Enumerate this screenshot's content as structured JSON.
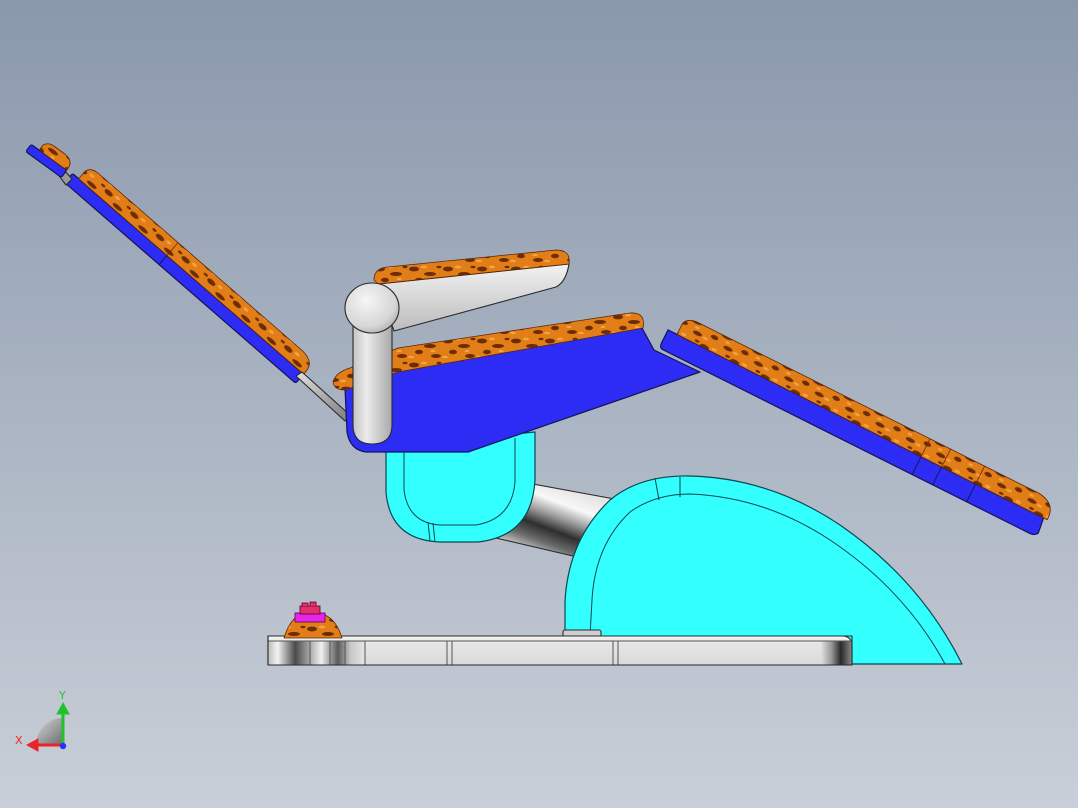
{
  "viewport": {
    "background_top": "#8a98ac",
    "background_bottom": "#c9cfd8"
  },
  "model": {
    "colors": {
      "frame": "#2c2cf5",
      "frame_edge": "#14145a",
      "cushion": "#e27e18",
      "cushion_spot": "#6e2c06",
      "cushion_light": "#f4a444",
      "housing": "#33ffff",
      "housing_edge": "#0b4652",
      "metal": "#d8d8d8",
      "plate": "#e6e6e6",
      "foot_pad": "#e626e6",
      "foot_button": "#e2306c"
    }
  },
  "triad": {
    "icon": "reference-triad-icon",
    "x_label": "X",
    "y_label": "Y",
    "x_color": "#e8262a",
    "y_color": "#20c22a",
    "z_color": "#2233ff"
  }
}
